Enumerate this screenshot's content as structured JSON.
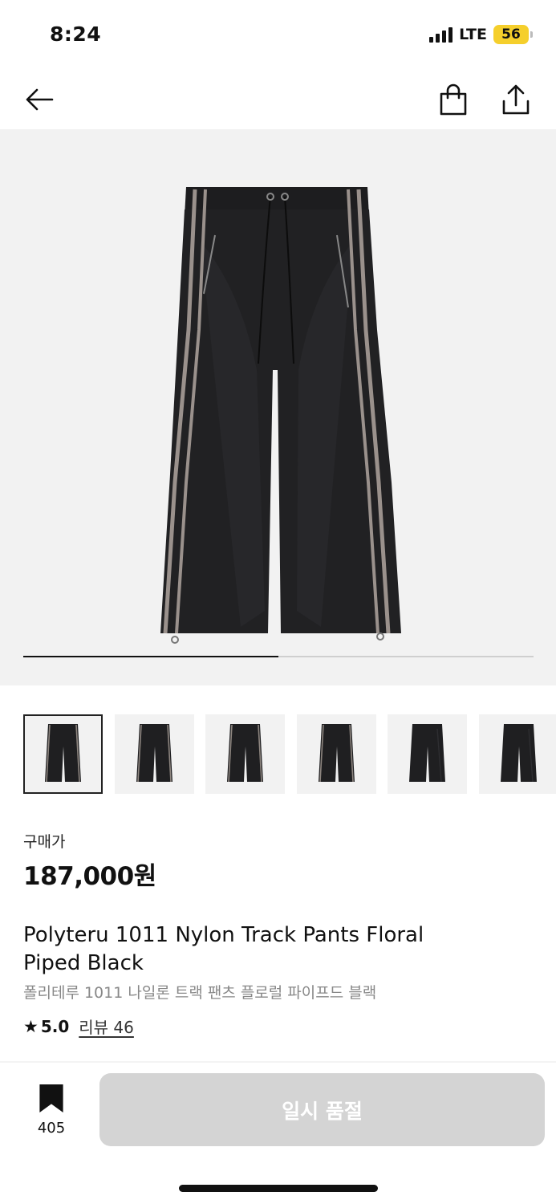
{
  "status_bar": {
    "time": "8:24",
    "network": "LTE",
    "battery": "56",
    "battery_color": "#f5cf2c"
  },
  "nav": {
    "back_icon": "arrow-left-icon",
    "cart_icon": "shopping-bag-icon",
    "share_icon": "share-icon"
  },
  "gallery": {
    "progress_fraction": 0.5,
    "thumbnails_visible": 6,
    "active_thumbnail": 1
  },
  "product": {
    "price_label": "구매가",
    "price": "187,000원",
    "title_en": "Polyteru 1011 Nylon Track Pants Floral Piped Black",
    "title_ko": "폴리테루 1011 나일론 트랙 팬츠 플로럴 파이프드 블랙",
    "rating_icon": "star-icon",
    "rating": "5.0",
    "reviews_link": "리뷰 46"
  },
  "bottom_bar": {
    "bookmark_icon": "bookmark-icon",
    "bookmark_count": "405",
    "action_label": "일시 품절",
    "action_color": "#d4d4d4"
  }
}
